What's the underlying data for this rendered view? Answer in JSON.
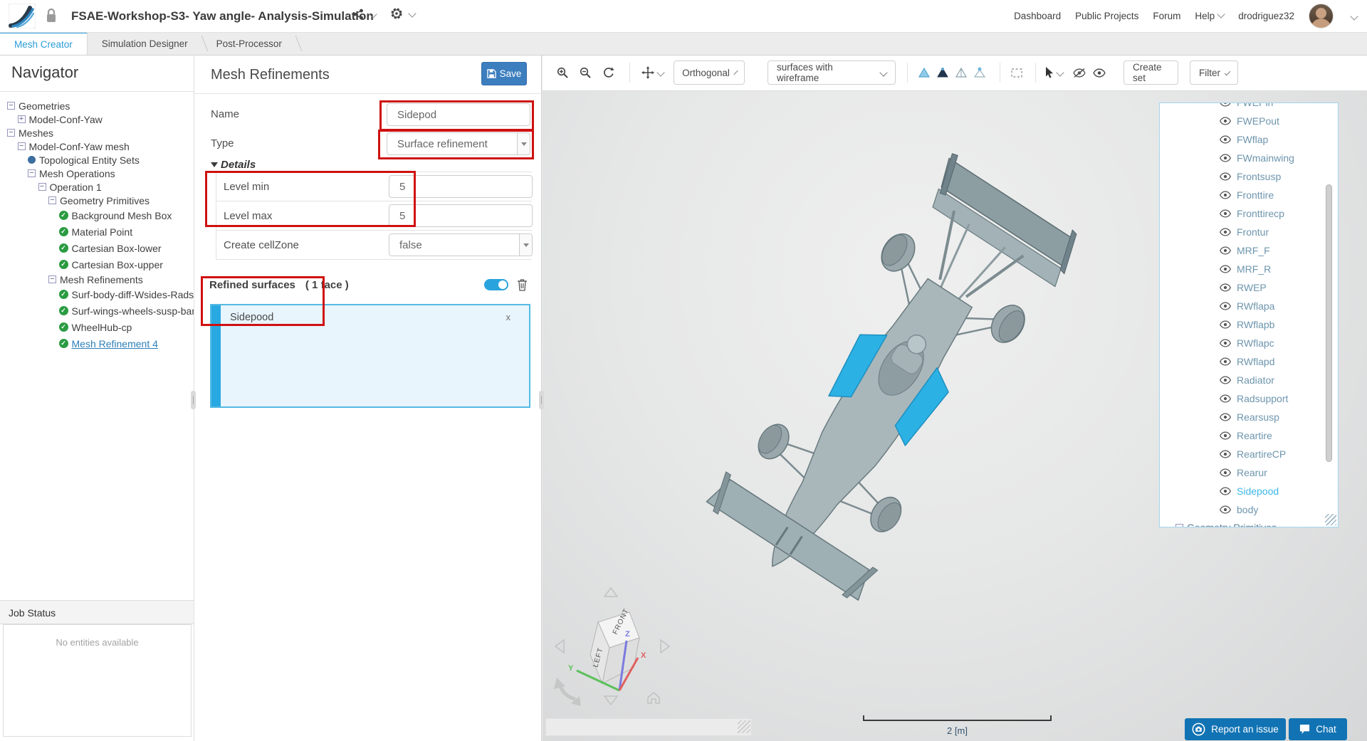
{
  "header": {
    "title": "FSAE-Workshop-S3- Yaw angle- Analysis-Simulation",
    "nav": {
      "dashboard": "Dashboard",
      "public_projects": "Public Projects",
      "forum": "Forum",
      "help": "Help",
      "username": "drodriguez32"
    }
  },
  "tabs": [
    {
      "label": "Mesh Creator",
      "active": true
    },
    {
      "label": "Simulation Designer",
      "active": false
    },
    {
      "label": "Post-Processor",
      "active": false
    }
  ],
  "navigator": {
    "title": "Navigator",
    "tree": [
      {
        "label": "Geometries",
        "icon": "minus",
        "depth": 0
      },
      {
        "label": "Model-Conf-Yaw",
        "icon": "plus",
        "depth": 1
      },
      {
        "label": "Meshes",
        "icon": "minus",
        "depth": 0
      },
      {
        "label": "Model-Conf-Yaw mesh",
        "icon": "minus",
        "depth": 1
      },
      {
        "label": "Topological Entity Sets",
        "icon": "dot",
        "depth": 2
      },
      {
        "label": "Mesh Operations",
        "icon": "minus",
        "depth": 2
      },
      {
        "label": "Operation 1",
        "icon": "minus",
        "depth": 3
      },
      {
        "label": "Geometry Primitives",
        "icon": "minus",
        "depth": 4
      },
      {
        "label": "Background Mesh Box",
        "icon": "check",
        "depth": 5
      },
      {
        "label": "Material Point",
        "icon": "check",
        "depth": 5
      },
      {
        "label": "Cartesian Box-lower",
        "icon": "check",
        "depth": 5
      },
      {
        "label": "Cartesian Box-upper",
        "icon": "check",
        "depth": 5
      },
      {
        "label": "Mesh Refinements",
        "icon": "minus",
        "depth": 4
      },
      {
        "label": "Surf-body-diff-Wsides-Radsup",
        "icon": "check",
        "depth": 5
      },
      {
        "label": "Surf-wings-wheels-susp-bars",
        "icon": "check",
        "depth": 5
      },
      {
        "label": "WheelHub-cp",
        "icon": "check",
        "depth": 5
      },
      {
        "label": "Mesh Refinement 4",
        "icon": "check",
        "depth": 5,
        "selected": true
      }
    ],
    "job_status": {
      "title": "Job Status",
      "empty": "No entities available"
    }
  },
  "editor": {
    "title": "Mesh Refinements",
    "save_label": "Save",
    "name_label": "Name",
    "name_value": "Sidepod",
    "type_label": "Type",
    "type_value": "Surface refinement",
    "details_label": "Details",
    "detail_rows": [
      {
        "label": "Level min",
        "value": "5",
        "widget": "input"
      },
      {
        "label": "Level max",
        "value": "5",
        "widget": "input"
      },
      {
        "label": "Create cellZone",
        "value": "false",
        "widget": "select"
      }
    ],
    "refined": {
      "label": "Refined surfaces",
      "count": "( 1 face )",
      "faces": [
        {
          "name": "Sidepood",
          "remove_glyph": "x"
        }
      ]
    }
  },
  "viewport": {
    "toolbar": {
      "projection": "Orthogonal",
      "render_mode": "surfaces with wireframe",
      "create_set": "Create set",
      "filter": "Filter"
    },
    "scale_label": "2 [m]",
    "cube": {
      "top_face": "FRONT",
      "side_face": "LEFT",
      "x": "X",
      "y": "Y",
      "z": "Z"
    },
    "footer": {
      "report": "Report an issue",
      "chat": "Chat"
    }
  },
  "scene_panel": {
    "items": [
      "FWEPin",
      "FWEPout",
      "FWflap",
      "FWmainwing",
      "Frontsusp",
      "Fronttire",
      "Fronttirecp",
      "Frontur",
      "MRF_F",
      "MRF_R",
      "RWEP",
      "RWflapa",
      "RWflapb",
      "RWflapc",
      "RWflapd",
      "Radiator",
      "Radsupport",
      "Rearsusp",
      "Reartire",
      "ReartireCP",
      "Rearur",
      "Sidepood",
      "body"
    ],
    "selected": "Sidepood",
    "footer": "Geometry Primitives"
  },
  "icons": {
    "share": "share-nodes",
    "settings": "gear",
    "lock": "padlock",
    "save": "floppy-disk",
    "delete": "trash",
    "zoom_in": "magnifier-plus",
    "zoom_out": "magnifier-minus",
    "reset_view": "refresh-arrows",
    "pan": "four-way-arrows",
    "select_box": "dashed-rectangle",
    "pointer": "cursor-arrow",
    "hide": "eye-slash",
    "show": "eye",
    "home": "house",
    "rotate_view": "curved-arrow"
  },
  "colors": {
    "accent_blue": "#2b9cd8",
    "save_button": "#3d7ebe",
    "annotation_red": "#cf1110",
    "highlight_cyan": "#2cb1e4",
    "footer_button_blue": "#1173b4",
    "check_green": "#2a9b41"
  }
}
